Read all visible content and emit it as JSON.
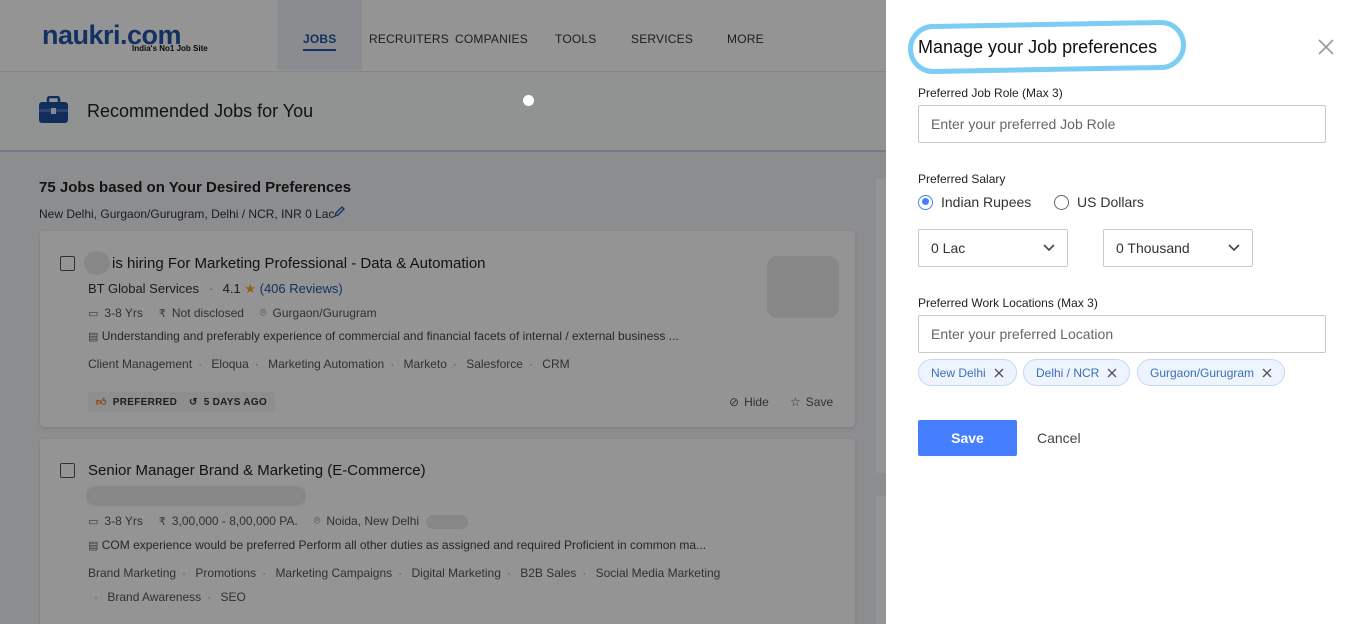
{
  "nav": {
    "logo": "naukri.com",
    "logo_tagline": "India's No1 Job Site",
    "links": [
      "JOBS",
      "RECRUITERS",
      "COMPANIES",
      "TOOLS",
      "SERVICES",
      "MORE"
    ]
  },
  "banner": {
    "title": "Recommended Jobs for You"
  },
  "results": {
    "count_title": "75 Jobs based on Your Desired Preferences",
    "subtitle": "New Delhi, Gurgaon/Gurugram, Delhi / NCR, INR 0 Lac"
  },
  "jobs": [
    {
      "title": "is hiring For Marketing Professional - Data & Automation",
      "company": "BT Global Services",
      "rating": "4.1",
      "reviews": "(406 Reviews)",
      "experience": "3-8 Yrs",
      "salary": "Not disclosed",
      "location": "Gurgaon/Gurugram",
      "description": "Understanding and preferably experience of commercial and financial facets of internal / external business ...",
      "tags": [
        "Client Management",
        "Eloqua",
        "Marketing Automation",
        "Marketo",
        "Salesforce",
        "CRM"
      ],
      "badge": "PREFERRED",
      "posted": "5 DAYS AGO",
      "hide_label": "Hide",
      "save_label": "Save"
    },
    {
      "title": "Senior Manager Brand & Marketing (E-Commerce)",
      "experience": "3-8 Yrs",
      "salary": "3,00,000 - 8,00,000 PA.",
      "location": "Noida, New Delhi",
      "description": "COM experience would be preferred Perform all other duties as assigned and required Proficient in common ma...",
      "tags": [
        "Brand Marketing",
        "Promotions",
        "Marketing Campaigns",
        "Digital Marketing",
        "B2B Sales",
        "Social Media Marketing"
      ],
      "tags_line2": [
        "Brand Awareness",
        "SEO"
      ]
    }
  ],
  "drawer": {
    "title": "Manage your Job preferences",
    "job_role_label": "Preferred Job Role (Max 3)",
    "job_role_placeholder": "Enter your preferred Job Role",
    "salary_label": "Preferred Salary",
    "currency_options": [
      "Indian Rupees",
      "US Dollars"
    ],
    "selected_currency": "Indian Rupees",
    "lac_value": "0 Lac",
    "thousand_value": "0 Thousand",
    "location_label": "Preferred Work Locations (Max 3)",
    "location_placeholder": "Enter your preferred Location",
    "locations": [
      "New Delhi",
      "Delhi / NCR",
      "Gurgaon/Gurugram"
    ],
    "save_label": "Save",
    "cancel_label": "Cancel",
    "highlight_color": "#7ccdf3",
    "accent_color": "#457eff"
  }
}
